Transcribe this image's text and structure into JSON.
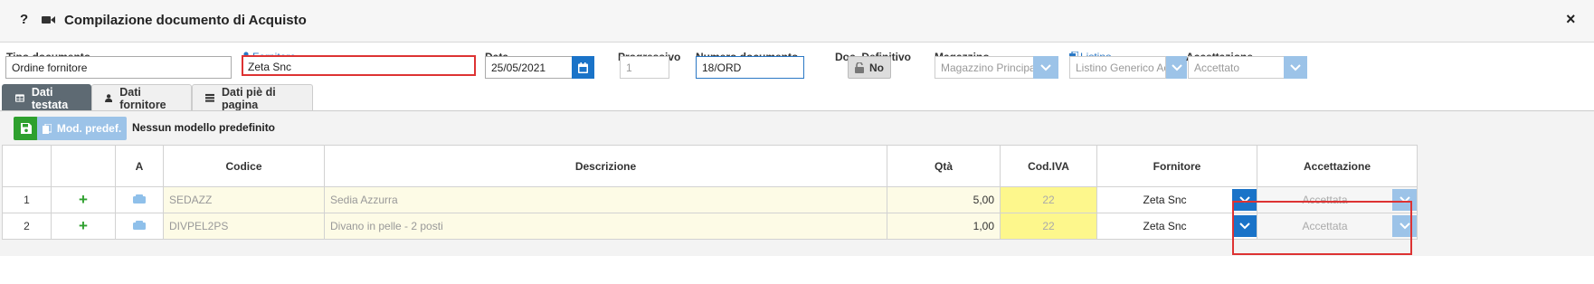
{
  "window": {
    "help": "?",
    "title": "Compilazione documento di Acquisto",
    "close": "×"
  },
  "form": {
    "tipo_label": "Tipo documento",
    "tipo_value": "Ordine fornitore",
    "fornitore_label": "Fornitore",
    "fornitore_value": "Zeta Snc",
    "data_label": "Data",
    "data_value": "25/05/2021",
    "progressivo_label": "Progressivo",
    "progressivo_value": "1",
    "numero_label": "Numero documento",
    "numero_value": "18/ORD",
    "definitivo_label": "Doc. Definitivo",
    "definitivo_value": "No",
    "magazzino_label": "Magazzino",
    "magazzino_value": "Magazzino Principal",
    "listino_label": "Listino",
    "listino_value": "Listino Generico Acc",
    "accettazione_label": "Accettazione",
    "accettazione_value": "Accettato"
  },
  "tabs": [
    {
      "label": "Dati testata",
      "active": true
    },
    {
      "label": "Dati fornitore",
      "active": false
    },
    {
      "label": "Dati piè di pagina",
      "active": false
    }
  ],
  "toolbar": {
    "mod_label": "Mod. predef.",
    "mod_status": "Nessun modello predefinito"
  },
  "grid": {
    "headers": [
      "",
      "",
      "A",
      "Codice",
      "Descrizione",
      "Qtà",
      "Cod.IVA",
      "Fornitore",
      "Accettazione"
    ],
    "rows": [
      {
        "num": "1",
        "add": "+",
        "codice": "SEDAZZ",
        "descrizione": "Sedia Azzurra",
        "qta": "5,00",
        "iva": "22",
        "fornitore": "Zeta Snc",
        "accettazione": "Accettata"
      },
      {
        "num": "2",
        "add": "+",
        "codice": "DIVPEL2PS",
        "descrizione": "Divano in pelle - 2 posti",
        "qta": "1,00",
        "iva": "22",
        "fornitore": "Zeta Snc",
        "accettazione": "Accettata"
      }
    ]
  },
  "colors": {
    "primary": "#1a73c8",
    "success": "#2ea02e",
    "highlight_red": "#dd3333",
    "tab_active": "#5e6a73",
    "row_yellow": "#fdfbe6",
    "iva_yellow": "#fdf78c"
  }
}
